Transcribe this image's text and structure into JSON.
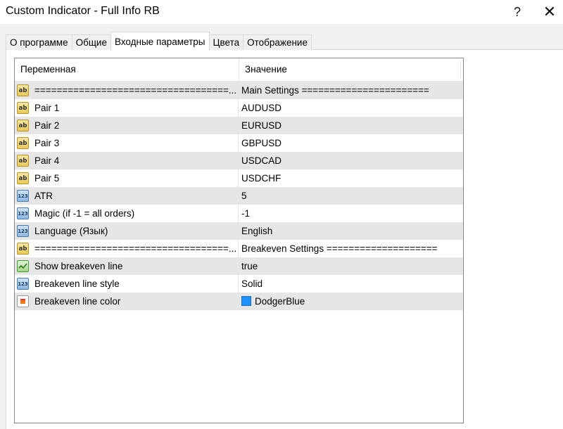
{
  "window": {
    "title": "Custom Indicator - Full Info RB",
    "help_label": "?",
    "close_label": "✕"
  },
  "tabs": [
    {
      "label": "О программе",
      "active": false
    },
    {
      "label": "Общие",
      "active": false
    },
    {
      "label": "Входные параметры",
      "active": true
    },
    {
      "label": "Цвета",
      "active": false
    },
    {
      "label": "Отображение",
      "active": false
    }
  ],
  "table": {
    "columns": [
      "Переменная",
      "Значение"
    ],
    "rows": [
      {
        "icon": "ab",
        "name": "===================================...",
        "value": "Main Settings ======================="
      },
      {
        "icon": "ab",
        "name": "Pair 1",
        "value": "AUDUSD"
      },
      {
        "icon": "ab",
        "name": "Pair 2",
        "value": "EURUSD"
      },
      {
        "icon": "ab",
        "name": "Pair 3",
        "value": "GBPUSD"
      },
      {
        "icon": "ab",
        "name": "Pair 4",
        "value": "USDCAD"
      },
      {
        "icon": "ab",
        "name": "Pair 5",
        "value": "USDCHF"
      },
      {
        "icon": "num",
        "name": "ATR",
        "value": "5"
      },
      {
        "icon": "num",
        "name": "Magic (if -1 = all orders)",
        "value": "-1"
      },
      {
        "icon": "num",
        "name": "Language (Язык)",
        "value": "English"
      },
      {
        "icon": "ab",
        "name": "===================================...",
        "value": "Breakeven Settings ===================="
      },
      {
        "icon": "chk",
        "name": "Show breakeven line",
        "value": "true"
      },
      {
        "icon": "num",
        "name": "Breakeven line style",
        "value": "Solid"
      },
      {
        "icon": "col",
        "name": "Breakeven line color",
        "value": "DodgerBlue",
        "swatch": "#1e90ff"
      }
    ]
  },
  "icon_labels": {
    "ab": "ab",
    "num": "123"
  }
}
